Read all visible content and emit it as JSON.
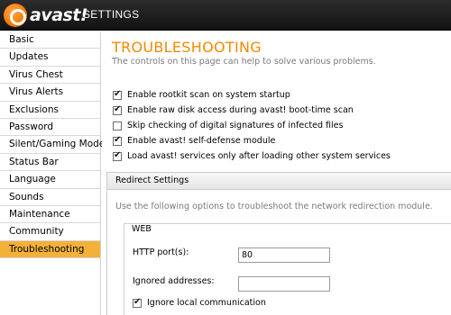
{
  "app": {
    "logo_text": "avast!",
    "window_title": "SETTINGS"
  },
  "sidebar": {
    "items": [
      {
        "label": "Basic",
        "active": false
      },
      {
        "label": "Updates",
        "active": false
      },
      {
        "label": "Virus Chest",
        "active": false
      },
      {
        "label": "Virus Alerts",
        "active": false
      },
      {
        "label": "Exclusions",
        "active": false
      },
      {
        "label": "Password",
        "active": false
      },
      {
        "label": "Silent/Gaming Mode",
        "active": false
      },
      {
        "label": "Status Bar",
        "active": false
      },
      {
        "label": "Language",
        "active": false
      },
      {
        "label": "Sounds",
        "active": false
      },
      {
        "label": "Maintenance",
        "active": false
      },
      {
        "label": "Community",
        "active": false
      },
      {
        "label": "Troubleshooting",
        "active": true
      }
    ]
  },
  "main": {
    "title": "TROUBLESHOOTING",
    "subtitle": "The controls on this page can help to solve various problems.",
    "options": [
      {
        "label": "Enable rootkit scan on system startup",
        "checked": true
      },
      {
        "label": "Enable raw disk access during avast! boot-time scan",
        "checked": true
      },
      {
        "label": "Skip checking of digital signatures of infected files",
        "checked": false
      },
      {
        "label": "Enable avast! self-defense module",
        "checked": true
      },
      {
        "label": "Load avast! services only after loading other system services",
        "checked": true
      }
    ],
    "redirect": {
      "header": "Redirect Settings",
      "description": "Use the following options to troubleshoot the network redirection module.",
      "web_group": {
        "title": "WEB",
        "http_ports_label": "HTTP port(s):",
        "http_ports_value": "80",
        "ignored_addresses_label": "Ignored addresses:",
        "ignored_addresses_value": "",
        "ignore_local_label": "Ignore local communication",
        "ignore_local_checked": true
      }
    }
  },
  "colors": {
    "accent": "#f08a00",
    "active_item": "#f3b13a",
    "titlebar": "#1c1c1c"
  }
}
